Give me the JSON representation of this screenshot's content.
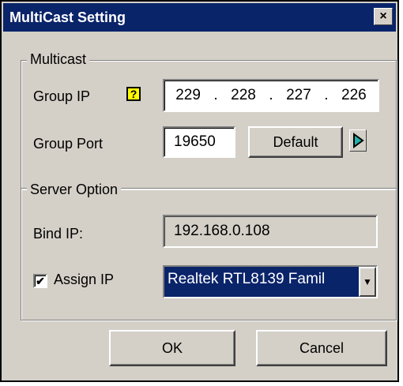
{
  "window": {
    "title": "MultiCast Setting",
    "close_glyph": "×"
  },
  "multicast": {
    "legend": "Multicast",
    "group_ip_label": "Group IP",
    "help_glyph": "?",
    "group_ip_parts": [
      "229",
      "228",
      "227",
      "226"
    ],
    "group_ip_sep": ".",
    "group_port_label": "Group Port",
    "group_port_value": "19650",
    "default_button": "Default"
  },
  "server": {
    "legend": "Server Option",
    "bind_ip_label": "Bind IP:",
    "bind_ip_value": "192.168.0.108",
    "assign_ip_checked": true,
    "check_glyph": "✔",
    "assign_ip_label": "Assign IP",
    "adapter_selected": "Realtek RTL8139 Famil"
  },
  "buttons": {
    "ok": "OK",
    "cancel": "Cancel"
  },
  "colors": {
    "titlebar": "#0a246a",
    "face": "#d4d0c8",
    "help": "#ffff00",
    "arrow_accent": "#20b2aa"
  }
}
